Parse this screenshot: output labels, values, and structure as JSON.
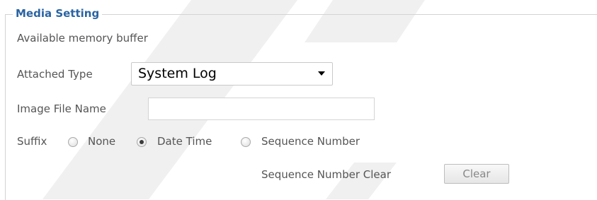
{
  "media_setting": {
    "legend": "Media Setting",
    "memory_label": "Available memory buffer",
    "attached_type": {
      "label": "Attached Type",
      "selected": "System Log"
    },
    "image_file_name": {
      "label": "Image File Name",
      "value": ""
    },
    "suffix": {
      "label": "Suffix",
      "options": [
        {
          "label": "None",
          "checked": false
        },
        {
          "label": "Date Time",
          "checked": true
        },
        {
          "label": "Sequence Number",
          "checked": false
        }
      ]
    },
    "sequence_clear": {
      "label": "Sequence Number Clear",
      "button": "Clear"
    }
  }
}
